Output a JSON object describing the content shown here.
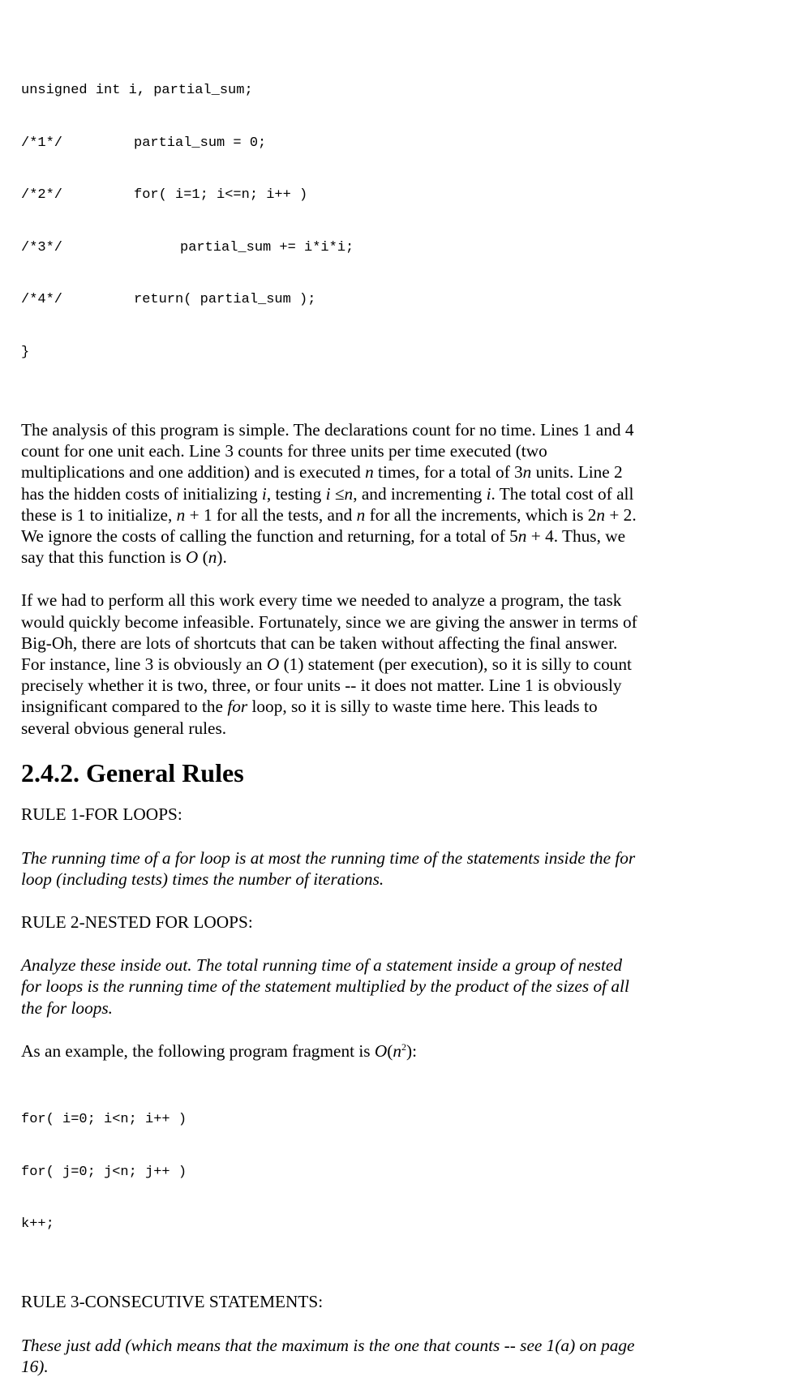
{
  "code1": {
    "decl": "unsigned int i, partial_sum;",
    "lines": [
      {
        "num": "/*1*/",
        "body": "partial_sum = 0;",
        "indent": 1
      },
      {
        "num": "/*2*/",
        "body": "for( i=1; i<=n; i++ )",
        "indent": 1
      },
      {
        "num": "/*3*/",
        "body": "partial_sum += i*i*i;",
        "indent": 2
      },
      {
        "num": "/*4*/",
        "body": "return( partial_sum );",
        "indent": 1
      }
    ],
    "close": "}"
  },
  "para1": {
    "t1": "The analysis of this program is simple. The declarations count for no time. Lines 1 and 4",
    "t2": "count for one unit each. Line 3 counts for three units per time executed (two",
    "t3a": "multiplications and one addition) and is executed ",
    "t3n": "n",
    "t3b": " times, for a total of 3",
    "t3n2": "n",
    "t3c": " units. Line 2",
    "t4a": "has the hidden costs of initializing ",
    "t4i": "i",
    "t4b": ", testing ",
    "t4i2": "i",
    "t4sym": " ≤",
    "t4n": "n",
    "t4c": ", and incrementing ",
    "t4i3": "i",
    "t4d": ". The total cost of all",
    "t5a": "these is 1 to initialize, ",
    "t5n": "n",
    "t5b": " + 1 for all the tests, and ",
    "t5n2": "n",
    "t5c": " for all the increments, which is 2",
    "t5n3": "n",
    "t5d": " + 2.",
    "t6a": "We ignore the costs of calling the function and returning, for a total of 5",
    "t6n": "n",
    "t6b": " + 4. Thus, we",
    "t7a": "say that this function is ",
    "t7o": "O",
    "t7b": " (",
    "t7n": "n",
    "t7c": ")."
  },
  "para2": {
    "t1": "If we had to perform all this work every time we needed to analyze a program, the task",
    "t2": "would quickly become infeasible. Fortunately, since we are giving the answer in terms of",
    "t3": "Big-Oh, there are lots of shortcuts that can be taken without affecting the final answer.",
    "t4a": "For instance, line 3 is obviously an ",
    "t4o": "O",
    "t4b": " (1) statement (per execution), so it is silly to count",
    "t5": "precisely whether it is two, three, or four units -- it does not matter. Line 1 is obviously",
    "t6a": "insignificant compared to the ",
    "t6for": "for",
    "t6b": " loop, so it is silly to waste time here. This leads to",
    "t7": "several obvious general rules."
  },
  "heading": "2.4.2. General Rules",
  "rule1": {
    "title": "RULE 1-FOR LOOPS:",
    "l1": "The running time of a for loop is at most the running time of the statements inside the for",
    "l2": "loop (including tests) times the number of iterations."
  },
  "rule2": {
    "title": "RULE 2-NESTED FOR LOOPS:",
    "l1": "Analyze these inside out. The total running time of a statement inside a group of nested",
    "l2": "for loops is the running time of the statement multiplied by the product of the sizes of all",
    "l3": "the for loops."
  },
  "example": {
    "a": "As an example, the following program fragment is ",
    "o": "O",
    "b": "(",
    "n": "n",
    "sup": "2",
    "c": "):"
  },
  "code2": [
    "for( i=0; i<n; i++ )",
    "for( j=0; j<n; j++ )",
    "k++;"
  ],
  "rule3": {
    "title": "RULE 3-CONSECUTIVE STATEMENTS:",
    "l1": "These just add (which means that the maximum is the one that counts -- see 1(a) on page",
    "l2": "16)."
  }
}
